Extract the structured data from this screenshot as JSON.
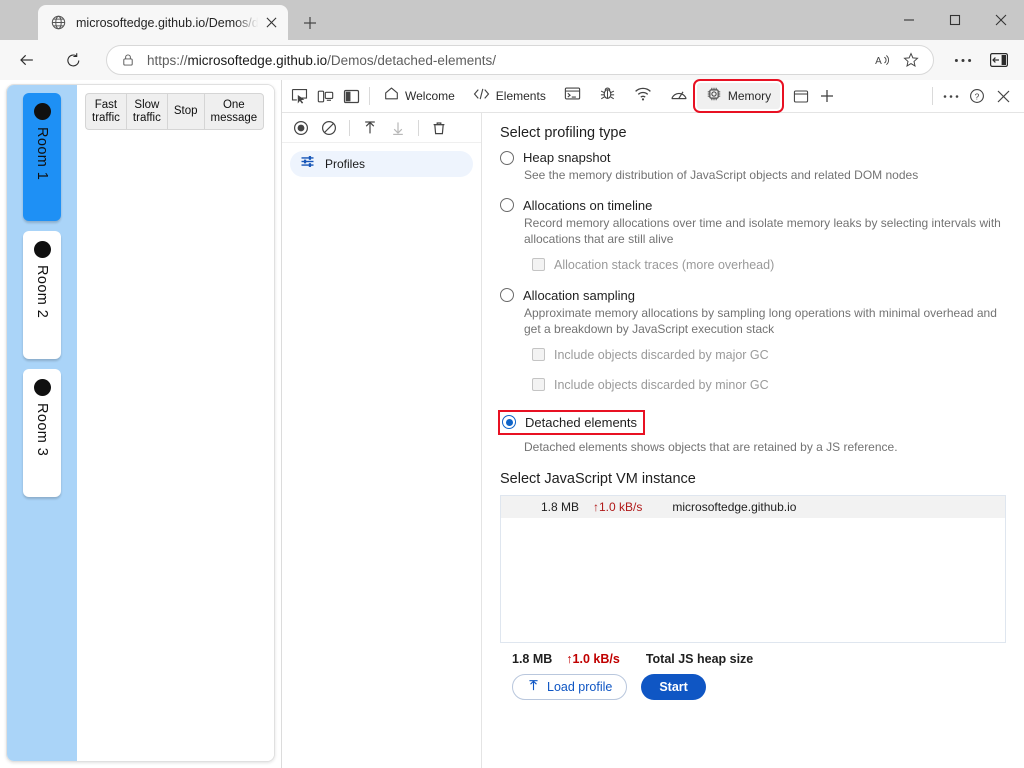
{
  "browser": {
    "tab": {
      "title": "microsoftedge.github.io/Demos/d",
      "favicon_icon": "globe-icon",
      "close_icon": "close-icon"
    },
    "new_tab_icon": "plus-icon",
    "window_controls": {
      "minimize_icon": "minimize-icon",
      "maximize_icon": "maximize-icon",
      "close_icon": "close-icon"
    },
    "nav": {
      "back_icon": "back-arrow-icon",
      "reload_icon": "reload-icon",
      "lock_icon": "lock-icon",
      "url_scheme": "https://",
      "url_domain": "microsoftedge.github.io",
      "url_path": "/Demos/detached-elements/",
      "read_aloud_icon": "read-aloud-icon",
      "favorite_icon": "star-icon",
      "settings_icon": "ellipsis-icon",
      "split_screen_icon": "sidebar-icon"
    }
  },
  "webpage": {
    "rooms": [
      {
        "label": "Room 1",
        "active": true
      },
      {
        "label": "Room 2",
        "active": false
      },
      {
        "label": "Room 3",
        "active": false
      }
    ],
    "traffic_buttons": [
      {
        "line1": "Fast",
        "line2": "traffic"
      },
      {
        "line1": "Slow",
        "line2": "traffic"
      },
      {
        "line1": "Stop",
        "line2": ""
      },
      {
        "line1": "One",
        "line2": "message"
      }
    ]
  },
  "devtools": {
    "toolbar_icons": [
      {
        "name": "inspect-element-icon"
      },
      {
        "name": "device-emulation-icon"
      },
      {
        "name": "dock-side-icon"
      }
    ],
    "tabs": [
      {
        "label": "Welcome",
        "icon": "home-icon",
        "selected": false,
        "highlighted": false
      },
      {
        "label": "Elements",
        "icon": "code-brackets-icon",
        "selected": false,
        "highlighted": false
      },
      {
        "label": "",
        "icon": "console-icon",
        "selected": false,
        "highlighted": false
      },
      {
        "label": "",
        "icon": "sources-bug-icon",
        "selected": false,
        "highlighted": false
      },
      {
        "label": "",
        "icon": "network-icon",
        "selected": false,
        "highlighted": false
      },
      {
        "label": "",
        "icon": "performance-gauge-icon",
        "selected": false,
        "highlighted": false
      },
      {
        "label": "Memory",
        "icon": "memory-chip-icon",
        "selected": true,
        "highlighted": true
      }
    ],
    "tabbar_right": {
      "more_tabs_icon": "panel-icon",
      "add_tab_icon": "plus-icon",
      "customize_icon": "ellipsis-icon",
      "help_icon": "question-circle-icon",
      "close_icon": "close-icon"
    },
    "left_toolbar": [
      {
        "name": "record-icon",
        "enabled": true
      },
      {
        "name": "clear-icon",
        "enabled": true
      },
      {
        "name": "load-profile-icon",
        "enabled": true
      },
      {
        "name": "save-profile-icon",
        "enabled": false
      },
      {
        "name": "delete-icon",
        "enabled": true
      }
    ],
    "profiles": {
      "icon": "filters-icon",
      "label": "Profiles"
    },
    "memory_panel": {
      "profiling_type_title": "Select profiling type",
      "options": [
        {
          "label": "Heap snapshot",
          "description": "See the memory distribution of JavaScript objects and related DOM nodes",
          "selected": false
        },
        {
          "label": "Allocations on timeline",
          "description": "Record memory allocations over time and isolate memory leaks by selecting intervals with allocations that are still alive",
          "selected": false,
          "sub_checkboxes": [
            {
              "label": "Allocation stack traces (more overhead)",
              "checked": false
            }
          ]
        },
        {
          "label": "Allocation sampling",
          "description": "Approximate memory allocations by sampling long operations with minimal overhead and get a breakdown by JavaScript execution stack",
          "selected": false,
          "sub_checkboxes": [
            {
              "label": "Include objects discarded by major GC",
              "checked": false
            },
            {
              "label": "Include objects discarded by minor GC",
              "checked": false
            }
          ]
        },
        {
          "label": "Detached elements",
          "description": "Detached elements shows objects that are retained by a JS reference.",
          "selected": true,
          "highlighted": true
        }
      ],
      "vm_title": "Select JavaScript VM instance",
      "vm_rows": [
        {
          "size": "1.8 MB",
          "rate": "↑1.0 kB/s",
          "host": "microsoftedge.github.io"
        }
      ],
      "total": {
        "size": "1.8 MB",
        "rate": "↑1.0 kB/s",
        "label": "Total JS heap size"
      },
      "load_profile_label": "Load profile",
      "load_profile_icon": "upload-arrow-icon",
      "start_label": "Start"
    }
  },
  "colors": {
    "accent_blue": "#0f56c4",
    "highlight_red": "#e81123",
    "room_rail": "#aad4f8",
    "room_active": "#1e90f5",
    "rate_red": "#b01818"
  }
}
